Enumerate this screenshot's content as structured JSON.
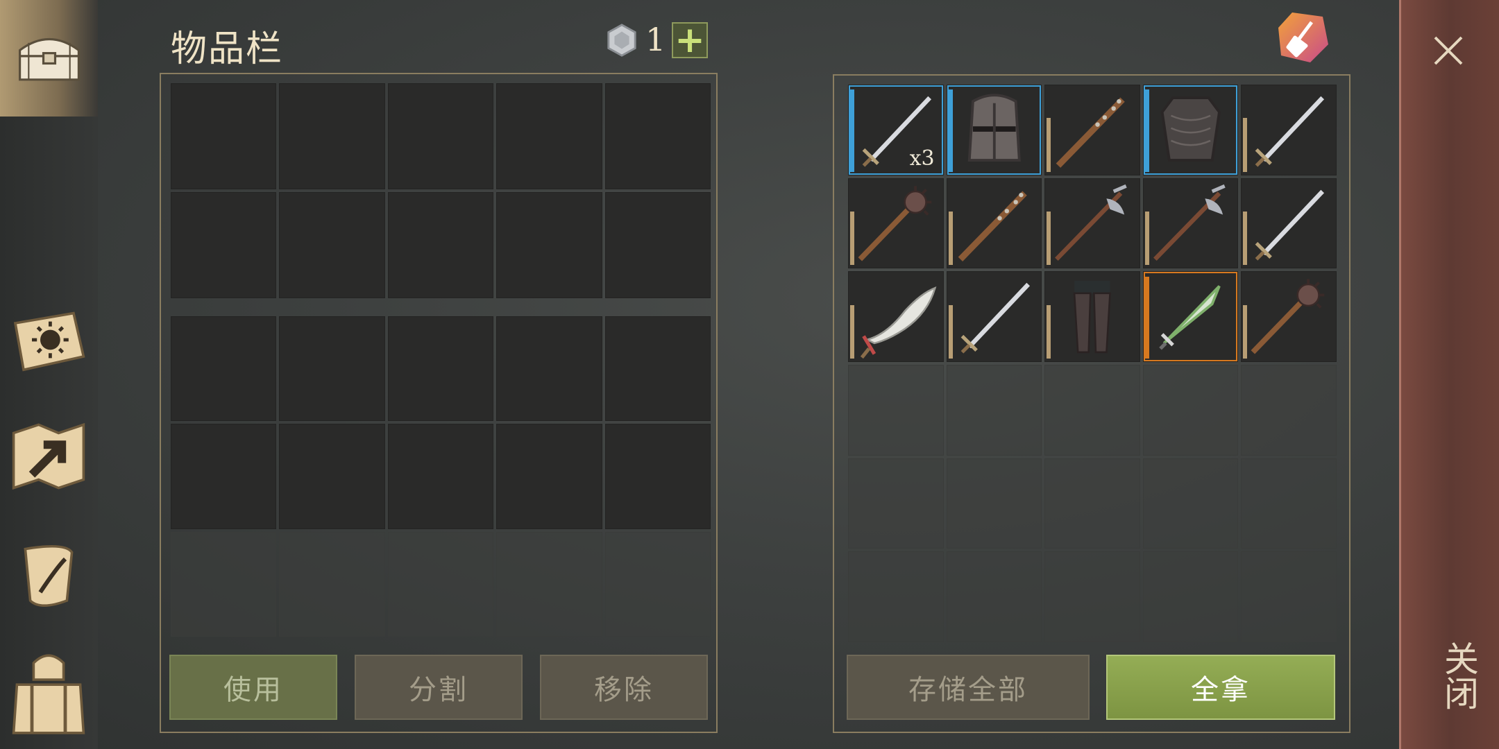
{
  "inventory": {
    "title": "物品栏",
    "coin_count": "1",
    "buttons": [
      "使用",
      "分割",
      "移除"
    ]
  },
  "loot": {
    "items": [
      {
        "icon": "sword-icon",
        "rarity": "blue",
        "qty": "x3"
      },
      {
        "icon": "great-helm-icon",
        "rarity": "blue"
      },
      {
        "icon": "spiked-club-icon",
        "rarity": "tan"
      },
      {
        "icon": "scale-armor-icon",
        "rarity": "blue"
      },
      {
        "icon": "sword-icon",
        "rarity": "tan"
      },
      {
        "icon": "mace-icon",
        "rarity": "tan"
      },
      {
        "icon": "spiked-club-icon",
        "rarity": "tan"
      },
      {
        "icon": "halberd-icon",
        "rarity": "tan"
      },
      {
        "icon": "halberd-icon",
        "rarity": "tan"
      },
      {
        "icon": "sword-icon",
        "rarity": "tan"
      },
      {
        "icon": "scimitar-icon",
        "rarity": "tan"
      },
      {
        "icon": "sword-icon",
        "rarity": "tan"
      },
      {
        "icon": "chainmail-leggings-icon",
        "rarity": "tan"
      },
      {
        "icon": "green-dagger-icon",
        "rarity": "orange"
      },
      {
        "icon": "mace-icon",
        "rarity": "tan"
      }
    ],
    "buttons": {
      "store_all": "存储全部",
      "take_all": "全拿"
    }
  },
  "close_label": "关闭",
  "sidebar_icons": [
    "chest-icon",
    "sun-book-icon",
    "map-icon",
    "scroll-icon",
    "backpack-icon"
  ],
  "colors": {
    "blue_rarity": "#3ea0d8",
    "orange_rarity": "#d7791f",
    "tan_rarity": "#b89e74"
  }
}
